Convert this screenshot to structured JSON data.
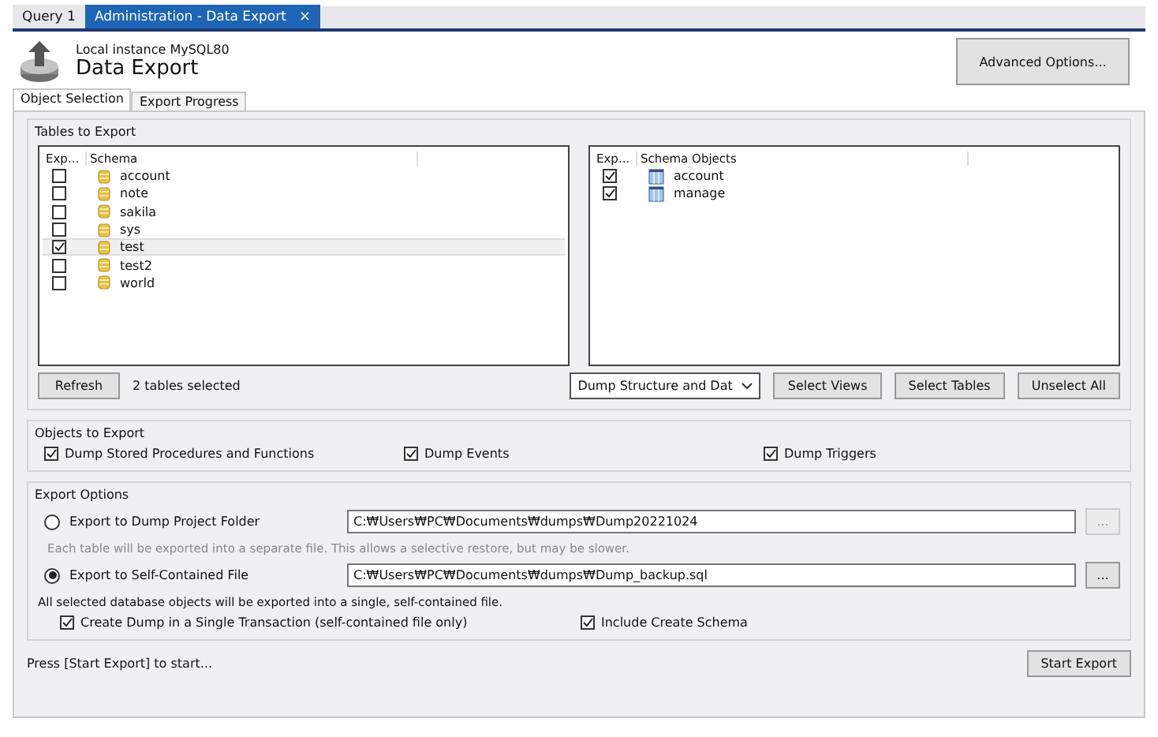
{
  "doc_tabs": [
    {
      "label": "Query 1",
      "selected": false
    },
    {
      "label": "Administration - Data Export",
      "selected": true,
      "close": "×"
    }
  ],
  "header": {
    "instance": "Local instance MySQL80",
    "title": "Data Export",
    "advanced_button": "Advanced Options..."
  },
  "tabs": [
    {
      "label": "Object Selection",
      "selected": true
    },
    {
      "label": "Export Progress",
      "selected": false
    }
  ],
  "tables_to_export": {
    "title": "Tables to Export",
    "schema_list": {
      "columns": [
        "Exp...",
        "Schema"
      ],
      "rows": [
        {
          "name": "account",
          "checked": false,
          "selected": false
        },
        {
          "name": "note",
          "checked": false,
          "selected": false
        },
        {
          "name": "sakila",
          "checked": false,
          "selected": false
        },
        {
          "name": "sys",
          "checked": false,
          "selected": false
        },
        {
          "name": "test",
          "checked": true,
          "selected": true
        },
        {
          "name": "test2",
          "checked": false,
          "selected": false
        },
        {
          "name": "world",
          "checked": false,
          "selected": false
        }
      ]
    },
    "objects_list": {
      "columns": [
        "Exp...",
        "Schema Objects"
      ],
      "rows": [
        {
          "name": "account",
          "checked": true
        },
        {
          "name": "manage",
          "checked": true
        }
      ]
    },
    "refresh_button": "Refresh",
    "selection_status": "2 tables selected",
    "dump_select": "Dump Structure and Dat",
    "buttons": [
      "Select Views",
      "Select Tables",
      "Unselect All"
    ]
  },
  "objects_to_export": {
    "title": "Objects to Export",
    "options": [
      {
        "label": "Dump Stored Procedures and Functions",
        "checked": true
      },
      {
        "label": "Dump Events",
        "checked": true
      },
      {
        "label": "Dump Triggers",
        "checked": true
      }
    ]
  },
  "export_options": {
    "title": "Export Options",
    "destinations": [
      {
        "label": "Export to Dump Project Folder",
        "selected": false,
        "path": "C:₩Users₩PC₩Documents₩dumps₩Dump20221024",
        "browse": "...",
        "browse_disabled": true,
        "note": "Each table will be exported into a separate file. This allows a selective restore, but may be slower.",
        "note_disabled": true
      },
      {
        "label": "Export to Self-Contained File",
        "selected": true,
        "path": "C:₩Users₩PC₩Documents₩dumps₩Dump_backup.sql",
        "browse": "...",
        "browse_disabled": false,
        "note": "All selected database objects will be exported into a single, self-contained file.",
        "note_disabled": false
      }
    ],
    "options": [
      {
        "label": "Create Dump in a Single Transaction (self-contained file only)",
        "checked": true
      },
      {
        "label": "Include Create Schema",
        "checked": true
      }
    ]
  },
  "footer": {
    "status": "Press [Start Export] to start...",
    "start_button": "Start Export"
  }
}
